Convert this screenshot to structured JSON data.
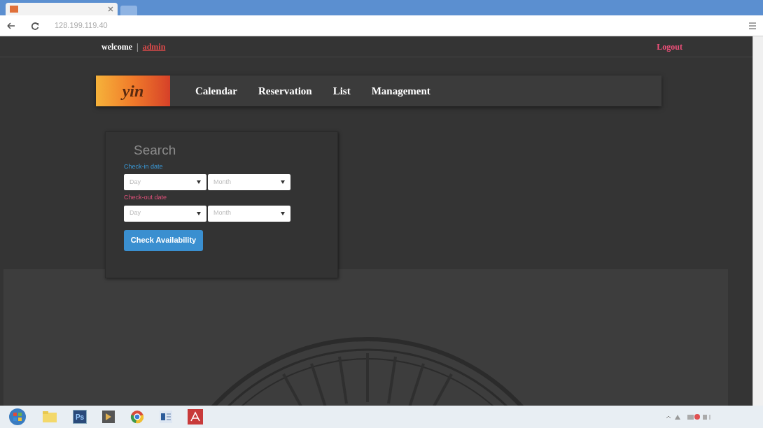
{
  "browser": {
    "address": "128.199.119.40"
  },
  "top_bar": {
    "welcome": "welcome",
    "separator": "|",
    "user": "admin",
    "logout": "Logout"
  },
  "logo": "yin",
  "nav": [
    {
      "label": "Calendar"
    },
    {
      "label": "Reservation"
    },
    {
      "label": "List"
    },
    {
      "label": "Management"
    }
  ],
  "search": {
    "title": "Search",
    "groups": [
      {
        "label": "Check-in date",
        "kind": "checkin",
        "selects": [
          {
            "placeholder": "Day"
          },
          {
            "placeholder": "Month"
          }
        ]
      },
      {
        "label": "Check-out date",
        "kind": "checkout",
        "selects": [
          {
            "placeholder": "Day"
          },
          {
            "placeholder": "Month"
          }
        ]
      }
    ],
    "button": "Check Availability"
  },
  "taskbar": [
    {
      "kind": "start"
    },
    {
      "kind": "folder"
    },
    {
      "kind": "app",
      "label": "Ps"
    },
    {
      "kind": "media"
    },
    {
      "kind": "browser"
    },
    {
      "kind": "word"
    },
    {
      "kind": "pdf"
    }
  ]
}
